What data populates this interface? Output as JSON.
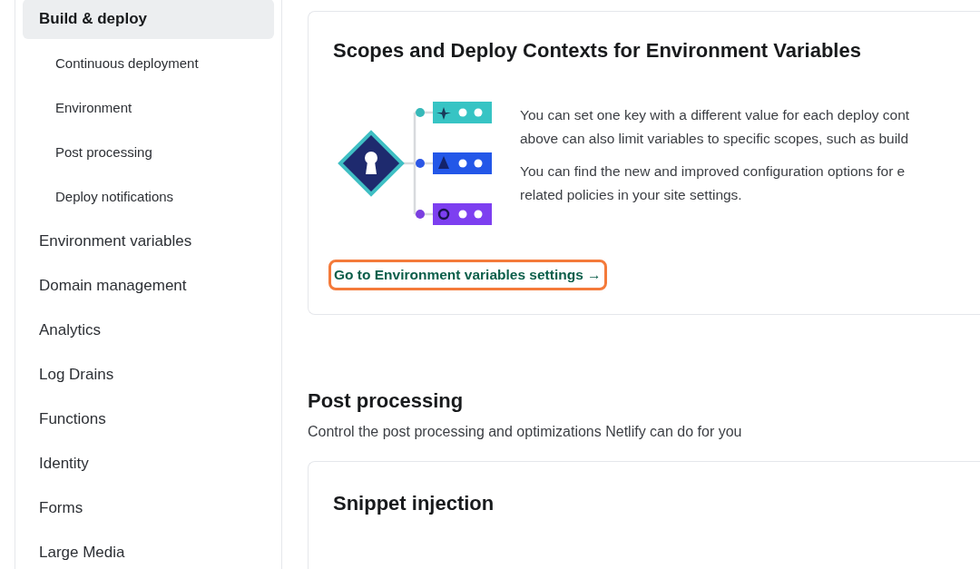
{
  "sidebar": {
    "items": [
      {
        "label": "Build & deploy",
        "selected": true,
        "children": [
          {
            "label": "Continuous deployment",
            "selected": false
          },
          {
            "label": "Environment",
            "selected": false
          },
          {
            "label": "Post processing",
            "selected": false
          },
          {
            "label": "Deploy notifications",
            "selected": false
          }
        ]
      },
      {
        "label": "Environment variables",
        "selected": false
      },
      {
        "label": "Domain management",
        "selected": false
      },
      {
        "label": "Analytics",
        "selected": false
      },
      {
        "label": "Log Drains",
        "selected": false
      },
      {
        "label": "Functions",
        "selected": false
      },
      {
        "label": "Identity",
        "selected": false
      },
      {
        "label": "Forms",
        "selected": false
      },
      {
        "label": "Large Media",
        "selected": false
      }
    ]
  },
  "scopes_card": {
    "title": "Scopes and Deploy Contexts for Environment Variables",
    "paragraphs": [
      [
        "You can set one key with a different value for each deploy cont",
        "above can also limit variables to specific scopes, such as build"
      ],
      [
        "You can find the new and improved configuration options for e",
        "related policies in your site settings."
      ]
    ],
    "link": {
      "label": "Go to Environment variables settings →",
      "highlighted": true
    }
  },
  "post_processing": {
    "title": "Post processing",
    "subtitle": "Control the post processing and optimizations Netlify can do for you"
  },
  "snippet_card": {
    "title": "Snippet injection"
  }
}
